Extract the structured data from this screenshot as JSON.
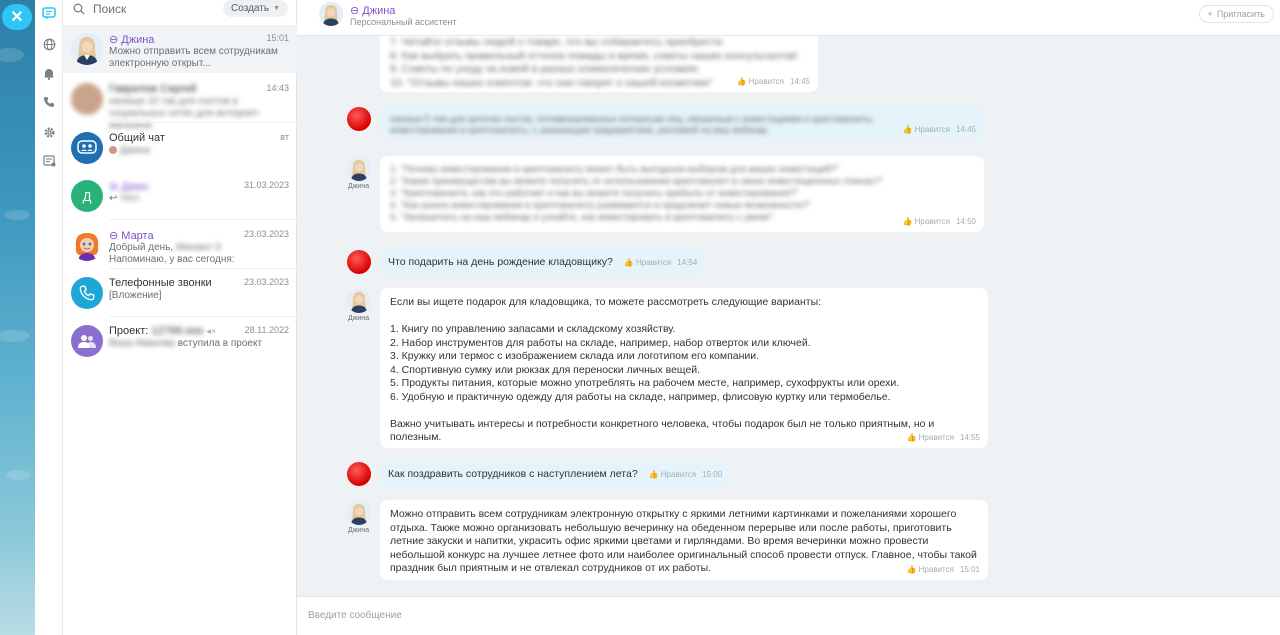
{
  "colors": {
    "accent": "#2fc6f6",
    "bot_name": "#7c52c7",
    "my_bubble": "#e5f4fb",
    "chat_bg": "#eef2f4"
  },
  "rail": {
    "icons": [
      "chat-icon",
      "globe-icon",
      "bell-icon",
      "phone-icon",
      "gear-icon",
      "notes-icon"
    ]
  },
  "search": {
    "label": "Поиск",
    "create_label": "Создать"
  },
  "chats": [
    {
      "name": "Джина",
      "time": "15:01",
      "preview": "Можно отправить всем сотрудникам электронную открыт..."
    },
    {
      "name": "Гаврилов Сергей",
      "time": "14:43",
      "preview": "напиши 10 так для постов в социальных сетях для интернет-магазина"
    },
    {
      "name": "Общий чат",
      "time": "вт",
      "preview": "Джина"
    },
    {
      "name": "Джин",
      "time": "31.03.2023",
      "preview": "тест",
      "avatar_letter": "Д"
    },
    {
      "name": "Марта",
      "time": "23.03.2023",
      "preview_1": "Добрый день,",
      "preview_1_blur": "Михаил З",
      "preview_2": "Напоминаю, у вас сегодня:"
    },
    {
      "name": "Телефонные звонки",
      "time": "23.03.2023",
      "preview": "[Вложение]"
    },
    {
      "name_prefix": "Проект:",
      "name_blur": "12766.ooo",
      "time": "28.11.2022",
      "preview_blur": "Вера Иванова",
      "preview": "вступила в проект"
    }
  ],
  "header": {
    "title": "Джина",
    "subtitle": "Персональный ассистент",
    "invite_label": "Пригласить"
  },
  "like_label": "Нравится",
  "bot_avatar_name": "Джина",
  "messages": [
    {
      "from": "bot",
      "blurred": true,
      "time": "14:45",
      "lines": [
        "7. Читайте отзывы людей о товаре, что вы собираетесь приобрести.",
        "8. Как выбрать правильный оттенок помады и время, советы наших консультантов!",
        "9. Советы по уходу за кожей в разных климатических условиях",
        "10. \"Отзывы наших клиентов: что они говорят о нашей косметике\""
      ]
    },
    {
      "from": "me",
      "blurred": true,
      "time": "14:45",
      "lines": [
        "напиши 5 тем для цепочки постов, оптимизированных интересам лиц, связанным с инвестициями в криптовалюты,",
        "инвестирования в криптовалюты, с уважающим предприятием, рекламой на ваш вебинар"
      ]
    },
    {
      "from": "bot",
      "blurred": true,
      "time": "14:50",
      "lines": [
        "1. \"Почему инвестирование в криптовалюту может быть выгодным выбором для ваших инвестиций?\"",
        "2. \"Какие преимущества вы можете получить от использования криптовалют в своих инвестиционных планах?\"",
        "3. \"Криптовалюта: как это работает и как вы можете получить прибыль от инвестирования?\"",
        "4. \"Как рынок инвестирования в криптовалюту развивается и предлагает новые возможности?\"",
        "5. \"Запишитесь на наш вебинар и узнайте, как инвестировать в криптовалюту с умом!\""
      ]
    },
    {
      "from": "me",
      "blurred": false,
      "time": "14:54",
      "text": "Что подарить на день рождение кладовщику?"
    },
    {
      "from": "bot",
      "blurred": false,
      "time": "14:55",
      "text": "Если вы ищете подарок для кладовщика, то можете рассмотреть следующие варианты:\n\n1. Книгу по управлению запасами и складскому хозяйству.\n2. Набор инструментов для работы на складе, например, набор отверток или ключей.\n3. Кружку или термос с изображением склада или логотипом его компании.\n4. Спортивную сумку или рюкзак для переноски личных вещей.\n5. Продукты питания, которые можно употреблять на рабочем месте, например, сухофрукты или орехи.\n6. Удобную и практичную одежду для работы на складе, например, флисовую куртку или термобелье.\n\nВажно учитывать интересы и потребности конкретного человека, чтобы подарок был не только приятным, но и полезным."
    },
    {
      "from": "me",
      "blurred": false,
      "time": "15:00",
      "text": "Как поздравить сотрудников с наступлением лета?"
    },
    {
      "from": "bot",
      "blurred": false,
      "time": "15:01",
      "text": "Можно отправить всем сотрудникам электронную открытку с яркими летними картинками и пожеланиями хорошего отдыха. Также можно организовать небольшую вечеринку на обеденном перерыве или после работы, приготовить летние закуски и напитки, украсить офис яркими цветами и гирляндами. Во время вечеринки можно провести небольшой конкурс на лучшее летнее фото или наиболее оригинальный способ провести отпуск. Главное, чтобы такой праздник был приятным и не отвлекал сотрудников от их работы."
    }
  ],
  "input": {
    "placeholder": "Введите сообщение"
  }
}
